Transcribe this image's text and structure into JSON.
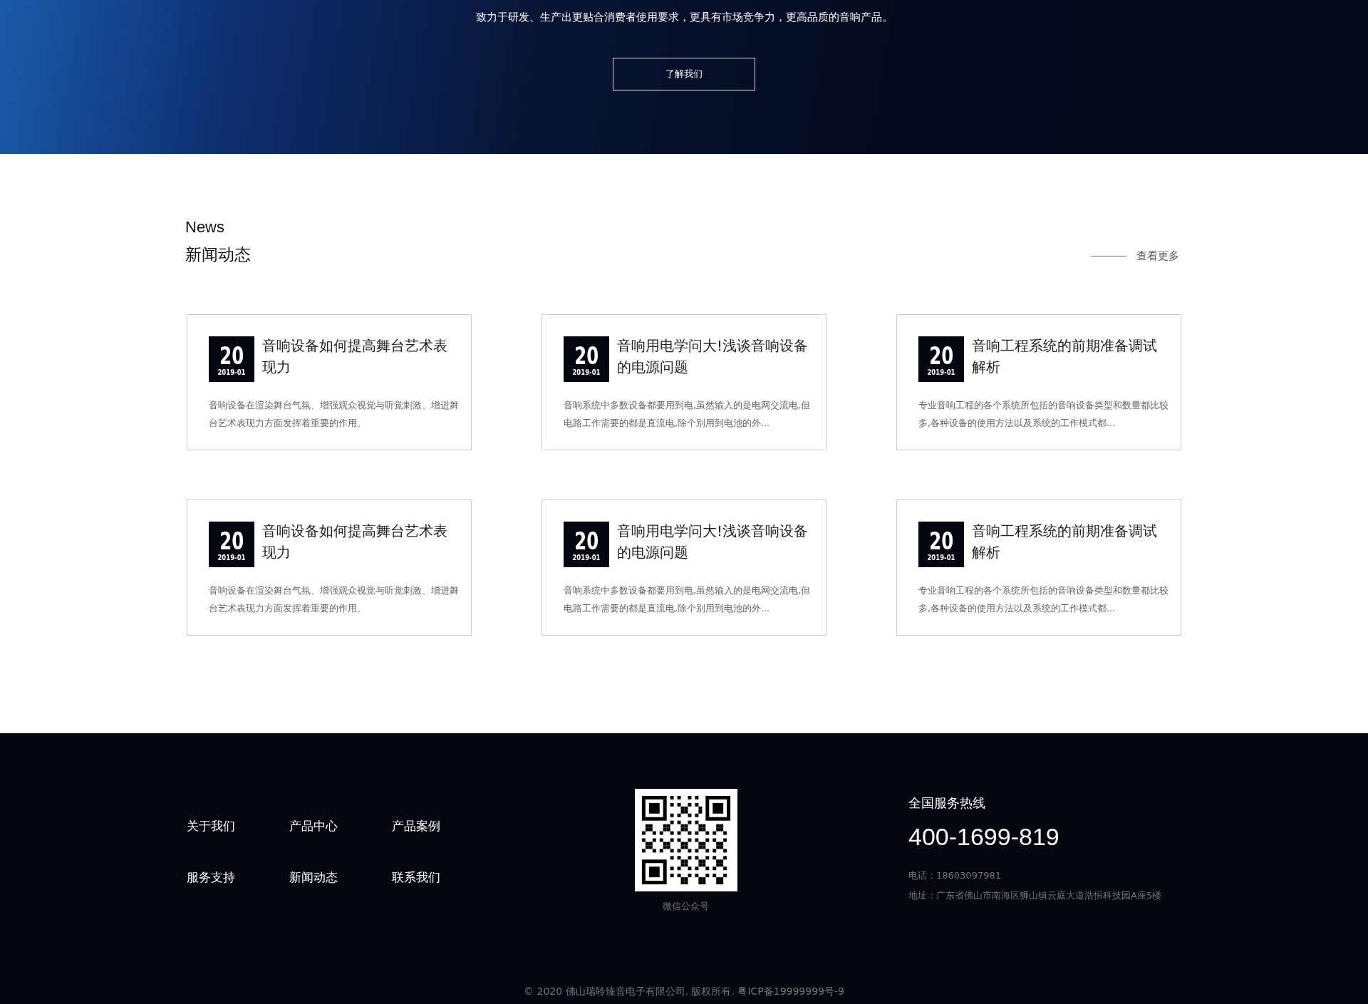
{
  "hero": {
    "text": "致力于研发、生产出更贴合消费者使用要求，更具有市场竞争力，更高品质的音响产品。",
    "button": "了解我们"
  },
  "news": {
    "subtitle": "News",
    "title": "新闻动态",
    "more": "查看更多",
    "items": [
      {
        "day": "20",
        "month": "2019-01",
        "title": "音响设备如何提高舞台艺术表现力",
        "summary": "音响设备在渲染舞台气氛、增强观众视觉与听觉刺激、增进舞台艺术表现力方面发挥着重要的作用。"
      },
      {
        "day": "20",
        "month": "2019-01",
        "title": "音响用电学问大!浅谈音响设备的电源问题",
        "summary": "音响系统中多数设备都要用到电,虽然输入的是电网交流电,但电路工作需要的都是直流电,除个别用到电池的外..."
      },
      {
        "day": "20",
        "month": "2019-01",
        "title": "音响工程系统的前期准备调试解析",
        "summary": "专业音响工程的各个系统所包括的音响设备类型和数量都比较多,各种设备的使用方法以及系统的工作模式都..."
      },
      {
        "day": "20",
        "month": "2019-01",
        "title": "音响设备如何提高舞台艺术表现力",
        "summary": "音响设备在渲染舞台气氛、增强观众视觉与听觉刺激、增进舞台艺术表现力方面发挥着重要的作用。"
      },
      {
        "day": "20",
        "month": "2019-01",
        "title": "音响用电学问大!浅谈音响设备的电源问题",
        "summary": "音响系统中多数设备都要用到电,虽然输入的是电网交流电,但电路工作需要的都是直流电,除个别用到电池的外..."
      },
      {
        "day": "20",
        "month": "2019-01",
        "title": "音响工程系统的前期准备调试解析",
        "summary": "专业音响工程的各个系统所包括的音响设备类型和数量都比较多,各种设备的使用方法以及系统的工作模式都..."
      }
    ]
  },
  "footer": {
    "links": [
      "关于我们",
      "产品中心",
      "产品案例",
      "服务支持",
      "新闻动态",
      "联系我们"
    ],
    "qr_caption": "微信公众号",
    "hotline_label": "全国服务热线",
    "hotline": "400-1699-819",
    "phone": "电话：18603097981",
    "address": "地址：广东省佛山市南海区狮山镇云庭大道浩恒科技园A座5楼",
    "copyright": "© 2020 佛山瑞聆臻音电子有限公司. 版权所有. 粤ICP备19999999号-9"
  }
}
